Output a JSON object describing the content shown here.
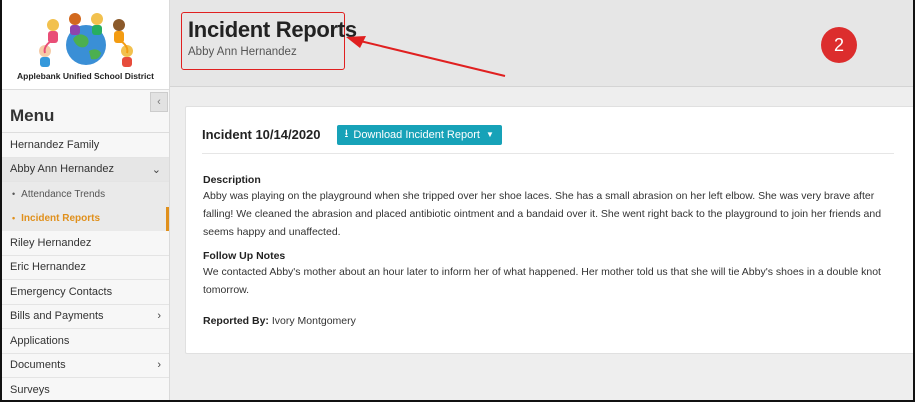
{
  "district": {
    "name": "Applebank Unified School District"
  },
  "sidebar": {
    "collapse_glyph": "‹",
    "menu_title": "Menu",
    "items": [
      {
        "label": "Hernandez Family"
      },
      {
        "label": "Abby Ann Hernandez",
        "expanded": true
      },
      {
        "label": "Attendance Trends",
        "sub": true
      },
      {
        "label": "Incident Reports",
        "sub": true,
        "active": true
      },
      {
        "label": "Riley Hernandez"
      },
      {
        "label": "Eric Hernandez"
      },
      {
        "label": "Emergency Contacts"
      },
      {
        "label": "Bills and Payments",
        "has_children": true
      },
      {
        "label": "Applications"
      },
      {
        "label": "Documents",
        "has_children": true
      },
      {
        "label": "Surveys"
      }
    ]
  },
  "header": {
    "title": "Incident Reports",
    "subtitle": "Abby Ann Hernandez",
    "step_badge": "2"
  },
  "incident": {
    "title": "Incident 10/14/2020",
    "download_label": "Download Incident Report",
    "description_label": "Description",
    "description": "Abby was playing on the playground when she tripped over her shoe laces. She has a small abrasion on her left elbow. She was very brave after falling! We cleaned the abrasion and placed antibiotic ointment and a bandaid over it. She went right back to the playground to join her friends and seems happy and unaffected.",
    "follow_up_label": "Follow Up Notes",
    "follow_up": "We contacted Abby's mother about an hour later to inform her of what happened. Her mother told us that she will tie Abby's shoes in a double knot tomorrow.",
    "reported_by_label": "Reported By:",
    "reported_by": "Ivory Montgomery"
  },
  "colors": {
    "accent_orange": "#e0901c",
    "button_teal": "#17a2b8",
    "annotation_red": "#e02020"
  }
}
